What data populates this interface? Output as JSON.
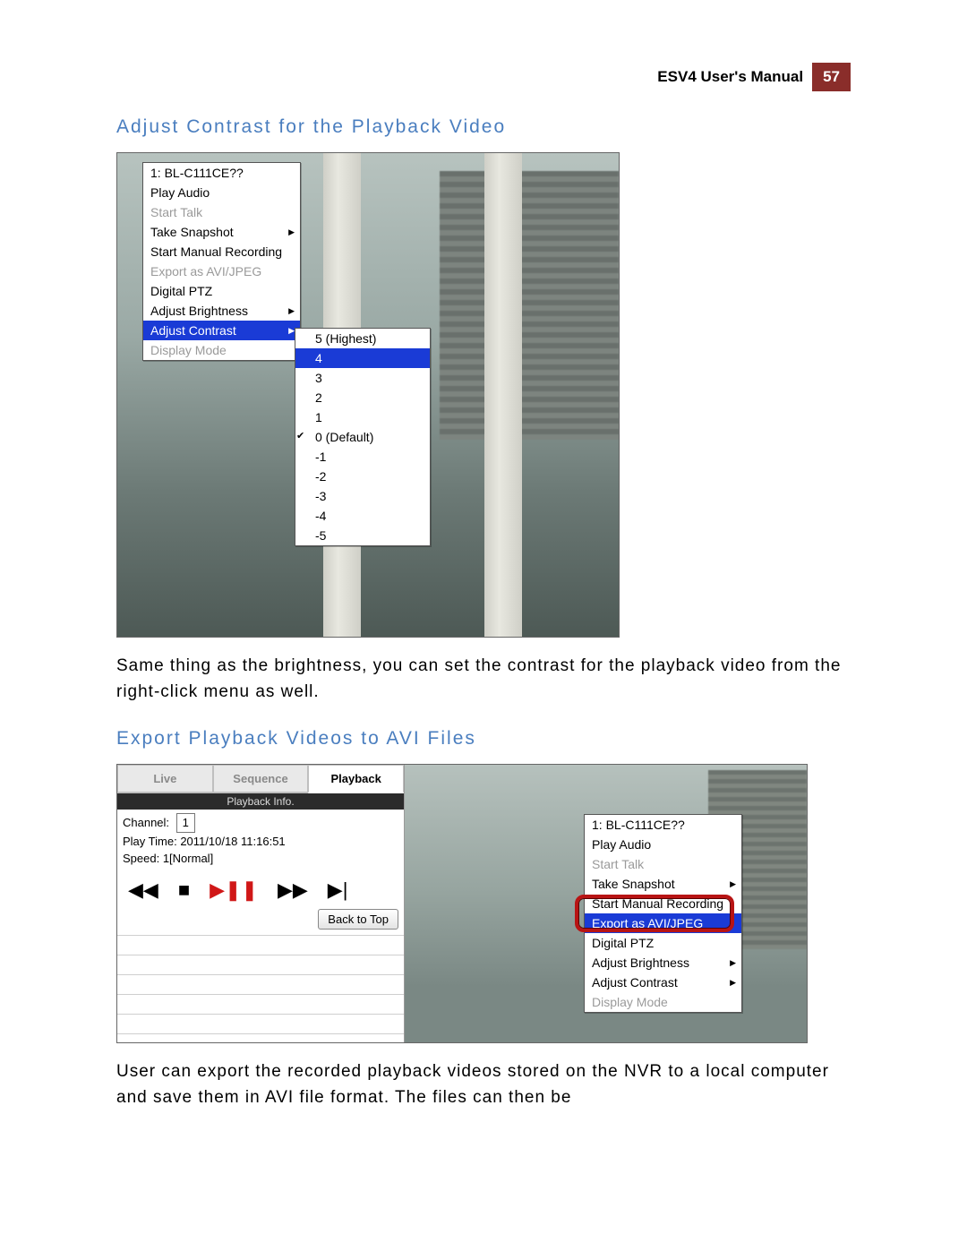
{
  "header": {
    "manual_title": "ESV4 User's Manual",
    "page_number": "57"
  },
  "section1": {
    "heading": "Adjust Contrast for the Playback Video",
    "body": "Same thing as the brightness, you can set the contrast for the playback video from the right-click menu as well."
  },
  "section2": {
    "heading": "Export Playback Videos to AVI Files",
    "body": "User can export the recorded playback videos stored on the NVR to a local computer and save them in AVI file format. The files can then be"
  },
  "menu_primary": {
    "items": [
      {
        "label": "1: BL-C111CE??",
        "state": "normal"
      },
      {
        "label": "Play Audio",
        "state": "normal"
      },
      {
        "label": "Start Talk",
        "state": "disabled"
      },
      {
        "label": "Take Snapshot",
        "state": "arrow"
      },
      {
        "label": "Start Manual Recording",
        "state": "normal"
      },
      {
        "label": "Export as AVI/JPEG",
        "state": "disabled"
      },
      {
        "label": "Digital PTZ",
        "state": "normal"
      },
      {
        "label": "Adjust Brightness",
        "state": "arrow"
      },
      {
        "label": "Adjust Contrast",
        "state": "selected-arrow"
      },
      {
        "label": "Display Mode",
        "state": "disabled"
      }
    ]
  },
  "menu_contrast": {
    "items": [
      {
        "label": "5 (Highest)"
      },
      {
        "label": "4",
        "selected": true
      },
      {
        "label": "3"
      },
      {
        "label": "2"
      },
      {
        "label": "1"
      },
      {
        "label": "0 (Default)",
        "check": true
      },
      {
        "label": "-1"
      },
      {
        "label": "-2"
      },
      {
        "label": "-3"
      },
      {
        "label": "-4"
      },
      {
        "label": "-5"
      }
    ]
  },
  "panel": {
    "tabs": {
      "live": "Live",
      "sequence": "Sequence",
      "playback": "Playback"
    },
    "info_header": "Playback Info.",
    "channel_label": "Channel:",
    "channel_value": "1",
    "playtime_label": "Play Time:",
    "playtime_value": "2011/10/18 11:16:51",
    "speed_label": "Speed:",
    "speed_value": "1[Normal]",
    "back_to_top": "Back to Top"
  },
  "menu_export": {
    "items": [
      {
        "label": "1: BL-C111CE??",
        "state": "normal"
      },
      {
        "label": "Play Audio",
        "state": "normal"
      },
      {
        "label": "Start Talk",
        "state": "disabled"
      },
      {
        "label": "Take Snapshot",
        "state": "arrow"
      },
      {
        "label": "Start Manual Recording",
        "state": "normal"
      },
      {
        "label": "Export as AVI/JPEG",
        "state": "selected"
      },
      {
        "label": "Digital PTZ",
        "state": "normal"
      },
      {
        "label": "Adjust Brightness",
        "state": "arrow"
      },
      {
        "label": "Adjust Contrast",
        "state": "arrow"
      },
      {
        "label": "Display Mode",
        "state": "disabled"
      }
    ]
  }
}
